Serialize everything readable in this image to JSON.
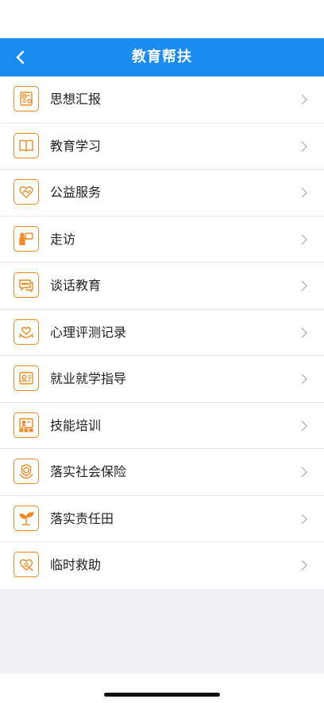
{
  "header": {
    "title": "教育帮扶"
  },
  "menu": [
    {
      "label": "思想汇报",
      "icon": "report-icon"
    },
    {
      "label": "教育学习",
      "icon": "book-icon"
    },
    {
      "label": "公益服务",
      "icon": "heart-hands-icon"
    },
    {
      "label": "走访",
      "icon": "visit-icon"
    },
    {
      "label": "谈话教育",
      "icon": "chat-icon"
    },
    {
      "label": "心理评测记录",
      "icon": "heart-care-icon"
    },
    {
      "label": "就业就学指导",
      "icon": "profile-card-icon"
    },
    {
      "label": "技能培训",
      "icon": "training-icon"
    },
    {
      "label": "落实社会保险",
      "icon": "insurance-badge-icon"
    },
    {
      "label": "落实责任田",
      "icon": "sprout-icon"
    },
    {
      "label": "临时救助",
      "icon": "rescue-heart-icon"
    }
  ],
  "colors": {
    "nav_bar": "#1a8cf0",
    "icon_accent": "#f08a24",
    "chevron": "#b8b8b8"
  }
}
